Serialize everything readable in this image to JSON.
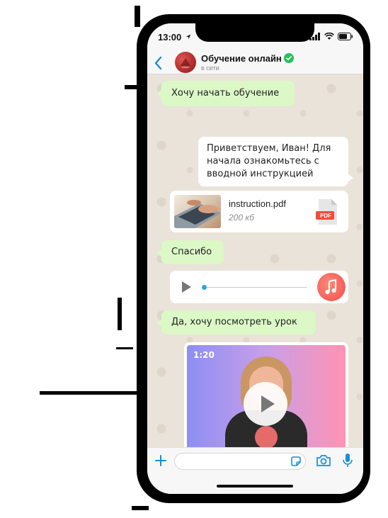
{
  "status_bar": {
    "time": "13:00"
  },
  "header": {
    "contact_name": "Обучение онлайн",
    "contact_status": "в сети"
  },
  "messages": [
    {
      "type": "text",
      "direction": "incoming",
      "text": "Хочу начать обучение"
    },
    {
      "type": "text",
      "direction": "outgoing",
      "text": "Приветствуем, Иван! Для начала ознакомьтесь с вводной инструкцией"
    },
    {
      "type": "file",
      "direction": "outgoing",
      "file_name": "instruction.pdf",
      "file_size": "200 кб",
      "file_badge": "PDF"
    },
    {
      "type": "text",
      "direction": "incoming",
      "text": "Спасибо"
    },
    {
      "type": "audio",
      "direction": "outgoing",
      "progress": 0.0
    },
    {
      "type": "text",
      "direction": "incoming",
      "text": "Да, хочу посмотреть урок"
    },
    {
      "type": "video",
      "direction": "outgoing",
      "duration": "1:20"
    }
  ],
  "colors": {
    "incoming_bubble": "#dcf8c6",
    "outgoing_bubble": "#ffffff",
    "accent": "#1a8cd8",
    "verified": "#25c15a",
    "music_button": "#ef4c4c"
  }
}
